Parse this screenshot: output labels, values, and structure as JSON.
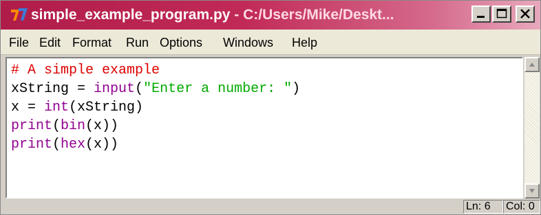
{
  "window": {
    "title_main": "simple_example_program.py",
    "title_sub": " - C:/Users/Mike/Deskt..."
  },
  "menu": [
    "File",
    "Edit",
    "Format",
    "Run",
    "Options",
    "Windows",
    "Help"
  ],
  "code": [
    [
      {
        "t": "# A simple example",
        "c": "comment"
      }
    ],
    [
      {
        "t": "xString = ",
        "c": "plain"
      },
      {
        "t": "input",
        "c": "builtin"
      },
      {
        "t": "(",
        "c": "plain"
      },
      {
        "t": "\"Enter a number: \"",
        "c": "string"
      },
      {
        "t": ")",
        "c": "plain"
      }
    ],
    [
      {
        "t": "x = ",
        "c": "plain"
      },
      {
        "t": "int",
        "c": "builtin"
      },
      {
        "t": "(xString)",
        "c": "plain"
      }
    ],
    [
      {
        "t": "print",
        "c": "builtin"
      },
      {
        "t": "(",
        "c": "plain"
      },
      {
        "t": "bin",
        "c": "builtin"
      },
      {
        "t": "(x))",
        "c": "plain"
      }
    ],
    [
      {
        "t": "print",
        "c": "builtin"
      },
      {
        "t": "(",
        "c": "plain"
      },
      {
        "t": "hex",
        "c": "builtin"
      },
      {
        "t": "(x))",
        "c": "plain"
      }
    ]
  ],
  "status": {
    "line": "Ln: 6",
    "col": "Col: 0"
  },
  "colors": {
    "comment": "#dd0000",
    "builtin": "#900090",
    "string": "#00aa00",
    "title_bar": "#b01c4a"
  },
  "icons": {
    "app": "python-idle-icon",
    "minimize": "minimize-icon",
    "maximize": "maximize-icon",
    "close": "close-icon",
    "scroll_up": "arrow-up-icon",
    "scroll_down": "arrow-down-icon"
  }
}
